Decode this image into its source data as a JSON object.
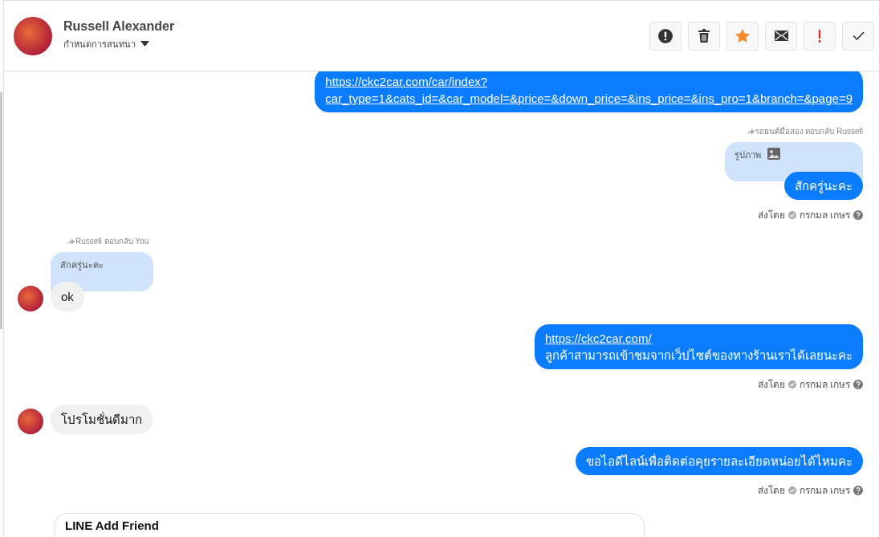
{
  "header": {
    "name": "Russell Alexander",
    "subtitle": "กำหนดการสนทนา",
    "actions": [
      {
        "kind": "alert"
      },
      {
        "kind": "trash"
      },
      {
        "kind": "star"
      },
      {
        "kind": "mail"
      },
      {
        "kind": "exclamation"
      },
      {
        "kind": "check"
      }
    ]
  },
  "messages": [
    {
      "kind": "outgoing",
      "link": "https://ckc2car.com/car/index?\ncar_type=1&cats_id=&car_model=&price=&down_price=&ins_price=&ins_pro=1&branch=&page=9"
    },
    {
      "kind": "outgoing",
      "reply_header": "รถยนต์มือสอง ตอบกลับ Russell",
      "quote": {
        "kind": "image",
        "text": "รูปภาพ"
      },
      "text": "สักครู่นะคะ",
      "sent_by_label": "ส่งโดย",
      "sent_by": "กรกมล เกษร"
    },
    {
      "kind": "incoming",
      "reply_header": "Russell ตอบกลับ You",
      "quote": {
        "text": "สักครู่นะคะ"
      },
      "text": "ok"
    },
    {
      "kind": "outgoing",
      "link": "https://ckc2car.com/",
      "text": "ลูกค้าสามารถเข้าชมจากเว็ปไซต์ของทางร้านเราได้เลยนะคะ",
      "sent_by_label": "ส่งโดย",
      "sent_by": "กรกมล เกษร"
    },
    {
      "kind": "incoming",
      "text": "โปรโมชั่นดีมาก"
    },
    {
      "kind": "outgoing",
      "text": "ขอไอดีไลน์เพื่อติดต่อคุยรายละเอียดหน่อยได้ไหมคะ",
      "sent_by_label": "ส่งโดย",
      "sent_by": "กรกมล เกษร"
    },
    {
      "kind": "card",
      "title": "LINE Add Friend"
    }
  ]
}
